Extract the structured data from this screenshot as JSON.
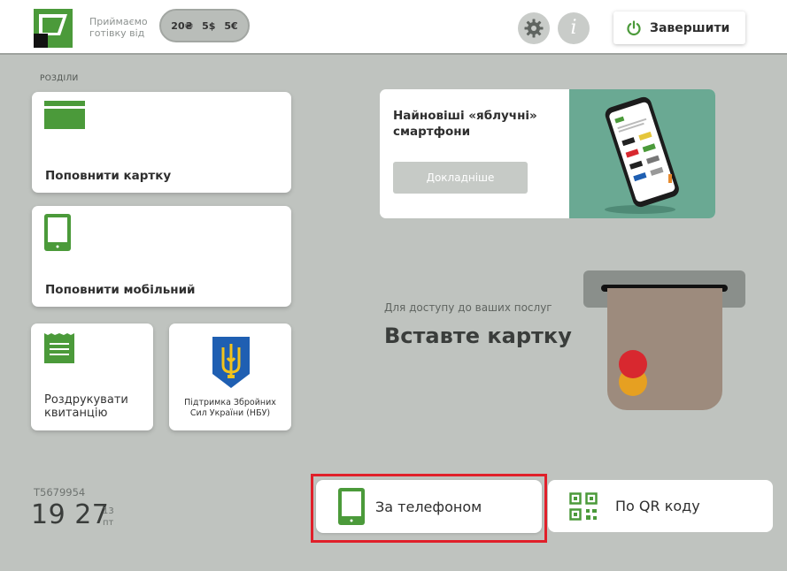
{
  "header": {
    "accept_text": "Приймаємо готівку від",
    "currencies": [
      "20₴",
      "5$",
      "5€"
    ],
    "finish_label": "Завершити",
    "icons": {
      "settings": "gear-icon",
      "info": "info-icon",
      "power": "power-icon"
    }
  },
  "sections": {
    "title": "РОЗДІЛИ",
    "items": [
      {
        "label": "Поповнити картку",
        "icon": "card-icon"
      },
      {
        "label": "Поповнити мобільний",
        "icon": "phone-icon"
      },
      {
        "label": "Роздрукувати квитанцію",
        "icon": "receipt-icon"
      },
      {
        "label": "Підтримка Збройних Сил України (НБУ)",
        "icon": "trident-icon"
      }
    ]
  },
  "promo": {
    "title": "Найновіші «яблучні» смартфони",
    "button_label": "Докладніше"
  },
  "insert": {
    "caption": "Для доступу до ваших послуг",
    "title": "Вставте картку"
  },
  "footer": {
    "terminal_id": "T5679954",
    "time": "19 27",
    "date_num": "13",
    "date_day": "пт"
  },
  "actions": {
    "phone_label": "За телефоном",
    "qr_label": "По QR коду"
  },
  "colors": {
    "brand_green": "#4b9a3a",
    "highlight_red": "#e0202a",
    "background": "#bfc3bf"
  }
}
